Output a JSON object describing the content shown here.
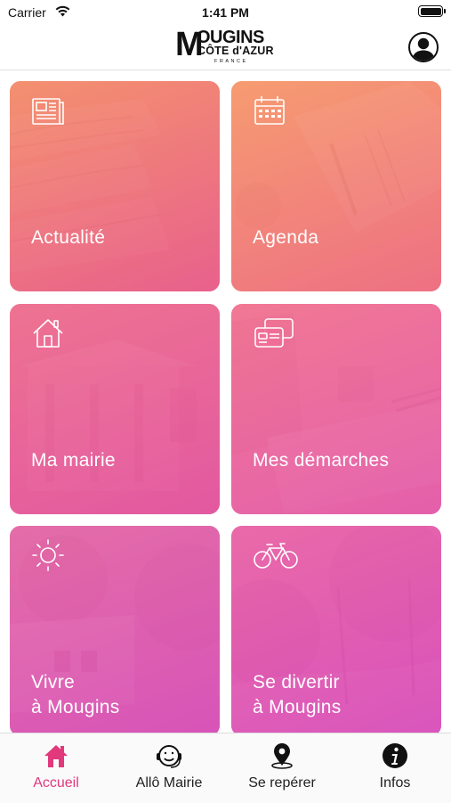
{
  "status_bar": {
    "carrier": "Carrier",
    "time": "1:41 PM",
    "battery_level": 1.0,
    "icons": [
      "wifi-icon",
      "battery-icon"
    ]
  },
  "header": {
    "logo": {
      "line1_initial": "M",
      "line1_rest": "OUGINS",
      "line2": "CÔTE d'AZUR",
      "line3": "FRANCE"
    },
    "account_icon": "user-circle-icon"
  },
  "tiles": [
    {
      "label": "Actualité",
      "icon": "newspaper-icon",
      "photo": "newspapers"
    },
    {
      "label": "Agenda",
      "icon": "calendar-icon",
      "photo": "notebook"
    },
    {
      "label": "Ma mairie",
      "icon": "house-icon",
      "photo": "town-hall"
    },
    {
      "label": "Mes démarches",
      "icon": "cards-icon",
      "photo": "laptop"
    },
    {
      "label_line1": "Vivre",
      "label_line2": "à Mougins",
      "icon": "sun-icon",
      "photo": "village"
    },
    {
      "label_line1": "Se divertir",
      "label_line2": "à Mougins",
      "icon": "bicycle-icon",
      "photo": "park"
    }
  ],
  "tab_bar": {
    "active_color": "#e2387c",
    "tabs": [
      {
        "label": "Accueil",
        "icon": "home-icon",
        "active": true
      },
      {
        "label": "Allô Mairie",
        "icon": "headset-icon",
        "active": false
      },
      {
        "label": "Se repérer",
        "icon": "map-pin-icon",
        "active": false
      },
      {
        "label": "Infos",
        "icon": "info-icon",
        "active": false
      }
    ]
  },
  "colors": {
    "tile_gradient_top": "#f58a6a",
    "tile_gradient_bottom": "#d84fb6",
    "accent": "#e2387c"
  }
}
